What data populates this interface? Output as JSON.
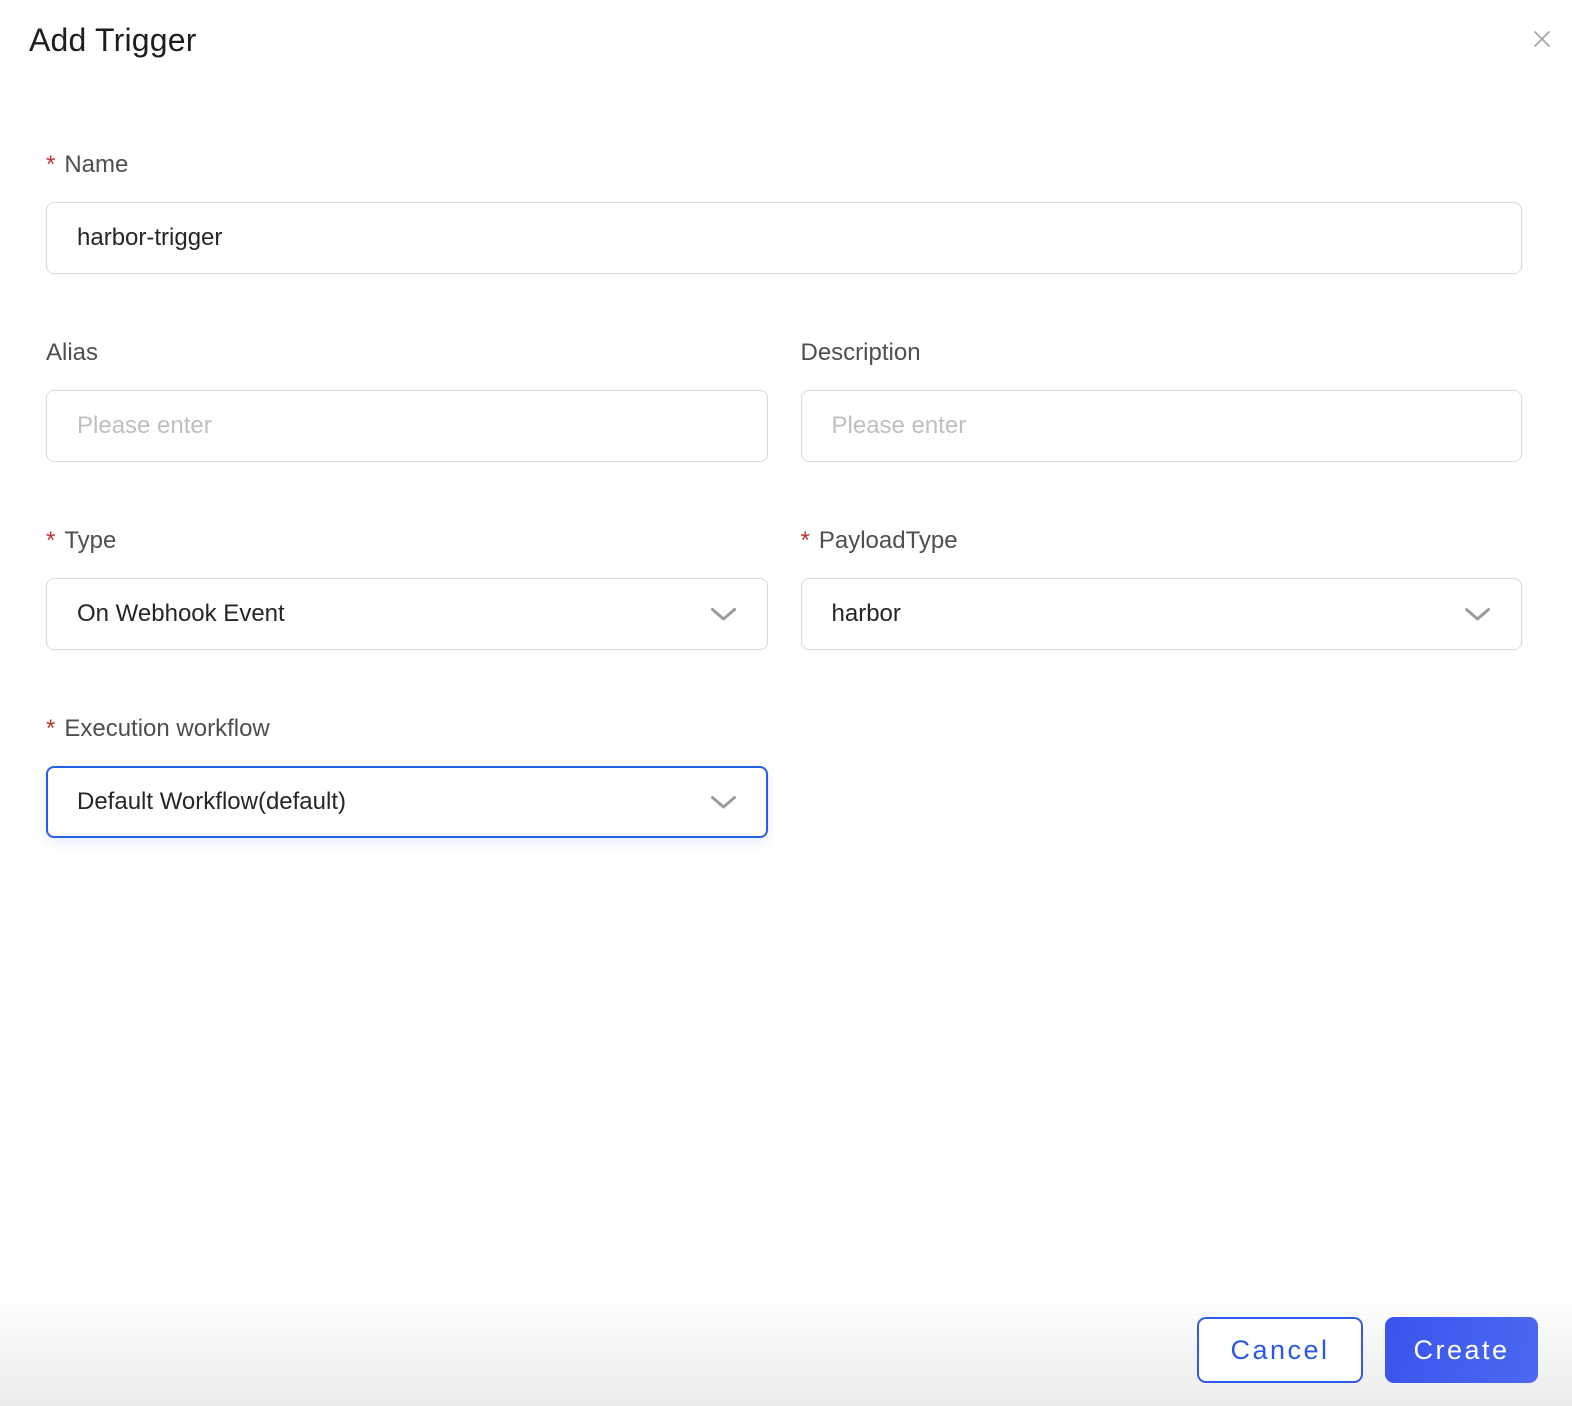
{
  "dialog": {
    "title": "Add Trigger"
  },
  "required_marker": "*",
  "fields": {
    "name": {
      "label": "Name",
      "required": true,
      "value": "harbor-trigger"
    },
    "alias": {
      "label": "Alias",
      "required": false,
      "value": "",
      "placeholder": "Please enter"
    },
    "description": {
      "label": "Description",
      "required": false,
      "value": "",
      "placeholder": "Please enter"
    },
    "type": {
      "label": "Type",
      "required": true,
      "value": "On Webhook Event"
    },
    "payload_type": {
      "label": "PayloadType",
      "required": true,
      "value": "harbor"
    },
    "execution_workflow": {
      "label": "Execution workflow",
      "required": true,
      "value": "Default Workflow(default)",
      "focused": true
    }
  },
  "buttons": {
    "cancel": "Cancel",
    "create": "Create"
  },
  "icons": {
    "close": "close-icon",
    "dropdown": "chevron-down-icon"
  },
  "colors": {
    "accent_blue": "#2e5be8",
    "primary_button_blue": "#4160ef",
    "focus_border_blue": "#2760e8",
    "required_red": "#bd352b",
    "input_border": "#d9d9d9",
    "label_text": "#4f4f4f",
    "input_text": "#262626",
    "placeholder_text": "#bfbfbf",
    "close_icon_gray": "#a6a6a6"
  }
}
